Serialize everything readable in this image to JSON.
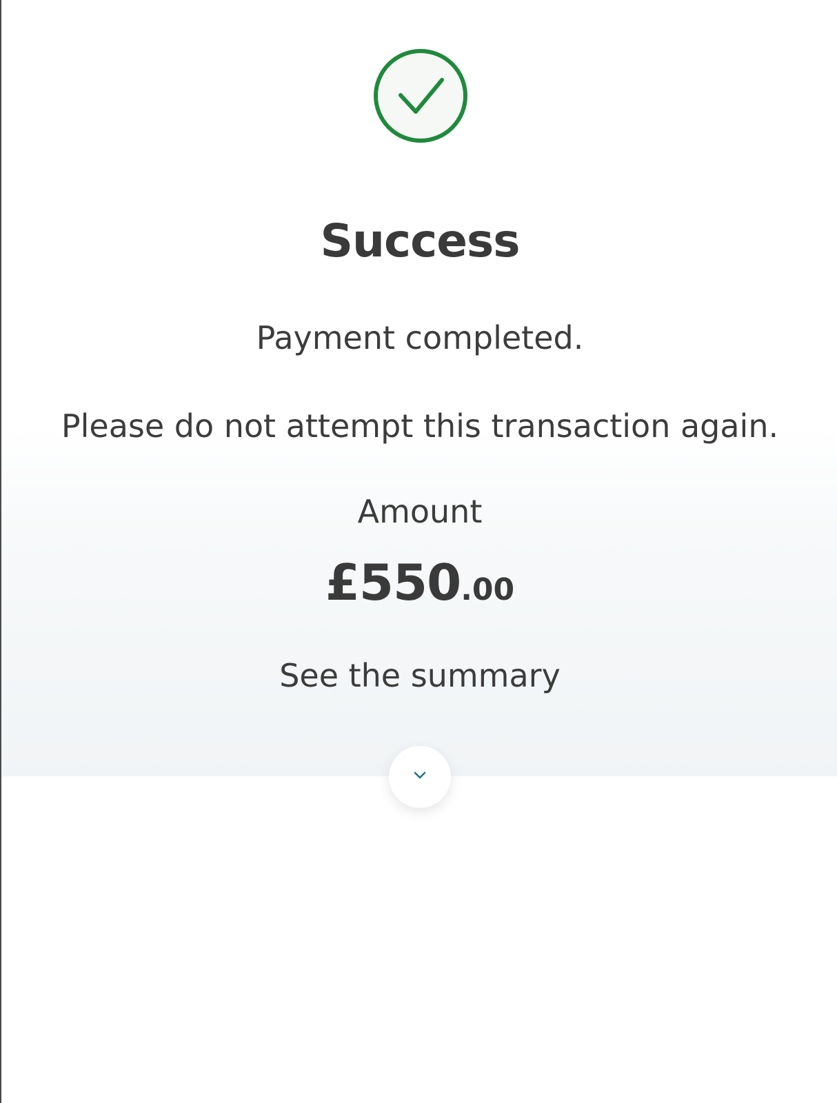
{
  "status": {
    "icon": "check-circle-icon",
    "title": "Success",
    "message": "Payment completed.",
    "warning": "Please do not attempt this transaction again."
  },
  "payment": {
    "amount_label": "Amount",
    "amount_major": "£550",
    "amount_minor": ".00"
  },
  "summary": {
    "link_label": "See the summary",
    "expand_icon": "chevron-down-icon"
  },
  "colors": {
    "success_green": "#1f8a3c",
    "text": "#3c3c3c",
    "panel_background": "#f1f4f6"
  }
}
